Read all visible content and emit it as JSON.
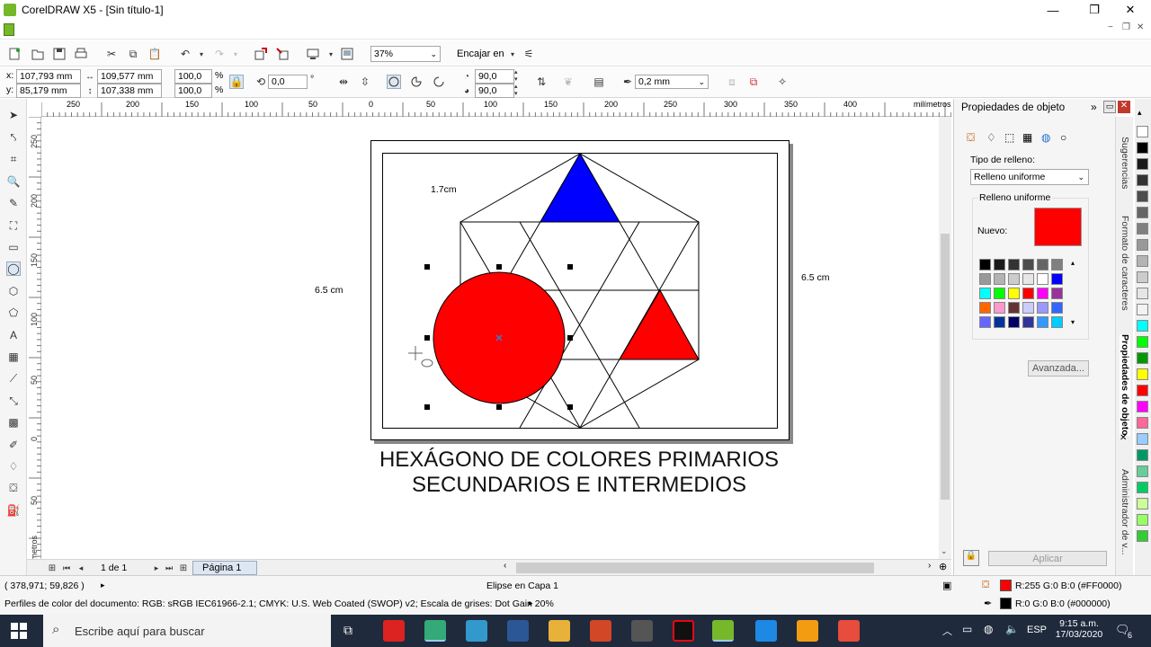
{
  "window": {
    "title": "CorelDRAW X5 - [Sin título-1]",
    "minimize": "—",
    "restore": "❐",
    "close": "✕"
  },
  "menubar": {
    "doc_controls": [
      "−",
      "❐",
      "✕"
    ]
  },
  "standard_toolbar": {
    "zoom_value": "37%",
    "snap_label": "Encajar en"
  },
  "property_bar": {
    "x_label": "x:",
    "x_value": "107,793 mm",
    "y_label": "y:",
    "y_value": "85,179 mm",
    "width_value": "109,577 mm",
    "height_value": "107,338 mm",
    "scale_x": "100,0",
    "scale_y": "100,0",
    "percent": "%",
    "rotation": "0,0",
    "degree": "°",
    "start_angle": "90,0",
    "end_angle": "90,0",
    "outline_width": "0,2 mm"
  },
  "rulers": {
    "h_ticks": [
      "250",
      "200",
      "150",
      "100",
      "50",
      "0",
      "50",
      "100",
      "150",
      "200",
      "250",
      "300",
      "350",
      "400"
    ],
    "h_unit": "milímetros",
    "v_ticks": [
      "250",
      "200",
      "150",
      "100",
      "50",
      "0",
      "50"
    ],
    "v_unit": "milímetros"
  },
  "drawing": {
    "dim_top": "1.7cm",
    "dim_left": "6.5 cm",
    "dim_right": "6.5 cm",
    "caption_line1": "HEXÁGONO DE COLORES PRIMARIOS",
    "caption_line2": "SECUNDARIOS E INTERMEDIOS"
  },
  "page_nav": {
    "page_count": "1 de 1",
    "page_tab": "Página 1"
  },
  "docker": {
    "title": "Propiedades de objeto",
    "fill_type_label": "Tipo de relleno:",
    "fill_type_value": "Relleno uniforme",
    "group_label": "Relleno uniforme",
    "new_label": "Nuevo:",
    "new_color": "#ff0000",
    "advanced_button": "Avanzada...",
    "apply_button": "Aplicar",
    "swatches": [
      "#000000",
      "#1a1a1a",
      "#333333",
      "#4d4d4d",
      "#666666",
      "#808080",
      "#999999",
      "#b3b3b3",
      "#cccccc",
      "#e6e6e6",
      "#ffffff",
      "#0000ff",
      "#00ffff",
      "#00ff00",
      "#ffff00",
      "#ff0000",
      "#ff00ff",
      "#993399",
      "#ff6600",
      "#ff99cc",
      "#663333",
      "#ccccff",
      "#9999ff",
      "#3366ff",
      "#6666ff",
      "#003399",
      "#000066",
      "#333399",
      "#3399ff",
      "#00ccff"
    ]
  },
  "docker_tabs": {
    "tab1": "Sugerencias",
    "tab2": "Formato de caracteres",
    "tab3": "Propiedades de objeto",
    "tab4": "Administrador de v..."
  },
  "palette": {
    "colors": [
      "#ffffff",
      "#000000",
      "#1a1a1a",
      "#333333",
      "#4d4d4d",
      "#666666",
      "#808080",
      "#999999",
      "#b3b3b3",
      "#cccccc",
      "#e6e6e6",
      "#f2f2f2",
      "#00ffff",
      "#00ff00",
      "#009900",
      "#ffff00",
      "#ff0000",
      "#ff00ff",
      "#ff6699",
      "#99ccff",
      "#009966",
      "#66cc99",
      "#00cc66",
      "#ccff99",
      "#99ff66",
      "#33cc33"
    ]
  },
  "statusbar": {
    "coords": "( 378,971; 59,826 )",
    "selection": "Elipse en Capa 1",
    "fill_info": "R:255 G:0 B:0 (#FF0000)",
    "fill_color": "#ff0000",
    "outline_info": "R:0 G:0 B:0 (#000000)",
    "outline_color": "#000000",
    "color_profiles": "Perfiles de color del documento: RGB: sRGB IEC61966-2.1; CMYK: U.S. Web Coated (SWOP) v2; Escala de grises: Dot Gain 20%"
  },
  "taskbar": {
    "search_placeholder": "Escribe aquí para buscar",
    "language": "ESP",
    "time": "9:15 a.m.",
    "date": "17/03/2020",
    "notification_count": "6"
  }
}
